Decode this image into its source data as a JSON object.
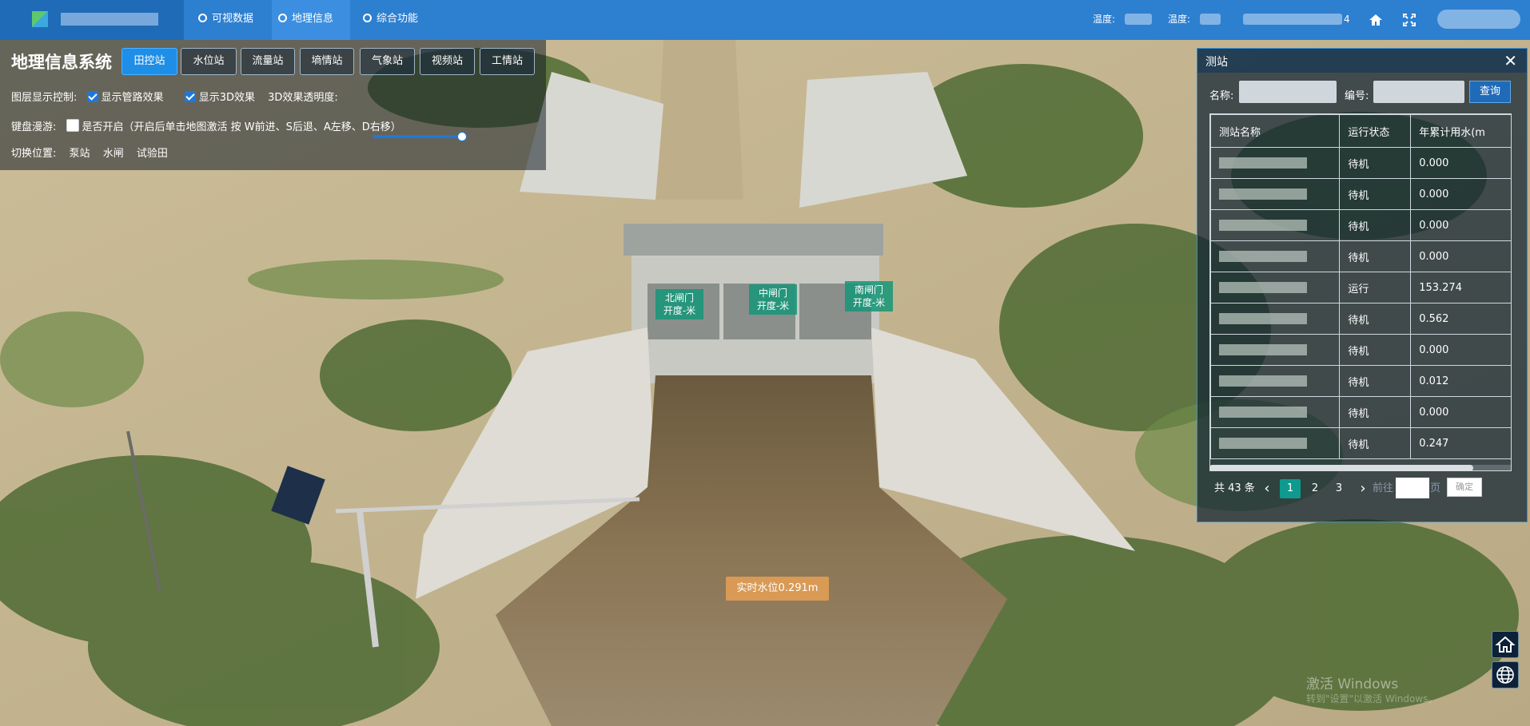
{
  "nav": {
    "items": [
      {
        "label": "可视数据",
        "active": false
      },
      {
        "label": "地理信息",
        "active": true
      },
      {
        "label": "综合功能",
        "active": false
      }
    ],
    "temp1_label": "温度:",
    "temp2_label": "温度:",
    "right_digit": "4",
    "home_icon": "home-icon",
    "fullscreen_icon": "fullscreen-icon"
  },
  "panel": {
    "title": "地理信息系统",
    "tabs": [
      "田控站",
      "水位站",
      "流量站",
      "墒情站",
      "气象站",
      "视频站",
      "工情站"
    ],
    "active_tab": "田控站",
    "layer_label": "图层显示控制:",
    "pipe_label": "显示管路效果",
    "pipe_checked": true,
    "effect3d_label": "显示3D效果",
    "effect3d_checked": true,
    "opacity_label": "3D效果透明度:",
    "opacity_value": 1.0,
    "keyboard_label": "键盘漫游:",
    "keyboard_option": "是否开启（开启后单击地图激活 按 W前进、S后退、A左移、D右移）",
    "keyboard_checked": false,
    "switch_label": "切换位置:",
    "switch_options": [
      "泵站",
      "水闸",
      "试验田"
    ]
  },
  "scene": {
    "gates": [
      {
        "name": "北闸门",
        "value": "开度-米"
      },
      {
        "name": "中闸门",
        "value": "开度-米"
      },
      {
        "name": "南闸门",
        "value": "开度-米"
      }
    ],
    "water_level": "实时水位0.291m"
  },
  "stations": {
    "title": "测站",
    "close": "✕",
    "name_label": "名称:",
    "code_label": "编号:",
    "query_button": "查询",
    "columns": [
      "测站名称",
      "运行状态",
      "年累计用水(m"
    ],
    "rows": [
      {
        "status": "待机",
        "value": "0.000"
      },
      {
        "status": "待机",
        "value": "0.000"
      },
      {
        "status": "待机",
        "value": "0.000"
      },
      {
        "status": "待机",
        "value": "0.000"
      },
      {
        "status": "运行",
        "value": "153.274"
      },
      {
        "status": "待机",
        "value": "0.562"
      },
      {
        "status": "待机",
        "value": "0.000"
      },
      {
        "status": "待机",
        "value": "0.012"
      },
      {
        "status": "待机",
        "value": "0.000"
      },
      {
        "status": "待机",
        "value": "0.247"
      }
    ],
    "total": "共 43 条",
    "pages": [
      "1",
      "2",
      "3"
    ],
    "current_page": "1",
    "prev": "‹",
    "next": "›",
    "goto_label": "前往",
    "page_suffix": "页",
    "confirm": "确定"
  },
  "watermark": {
    "line1": "激活 Windows",
    "line2": "转到\"设置\"以激活 Windows。"
  },
  "colors": {
    "topbar": "#2d7fd0",
    "active_tab": "#1f8ee6",
    "gate_label": "#14967880",
    "water_label": "#d99a55",
    "page_current": "#0f9a8f"
  }
}
